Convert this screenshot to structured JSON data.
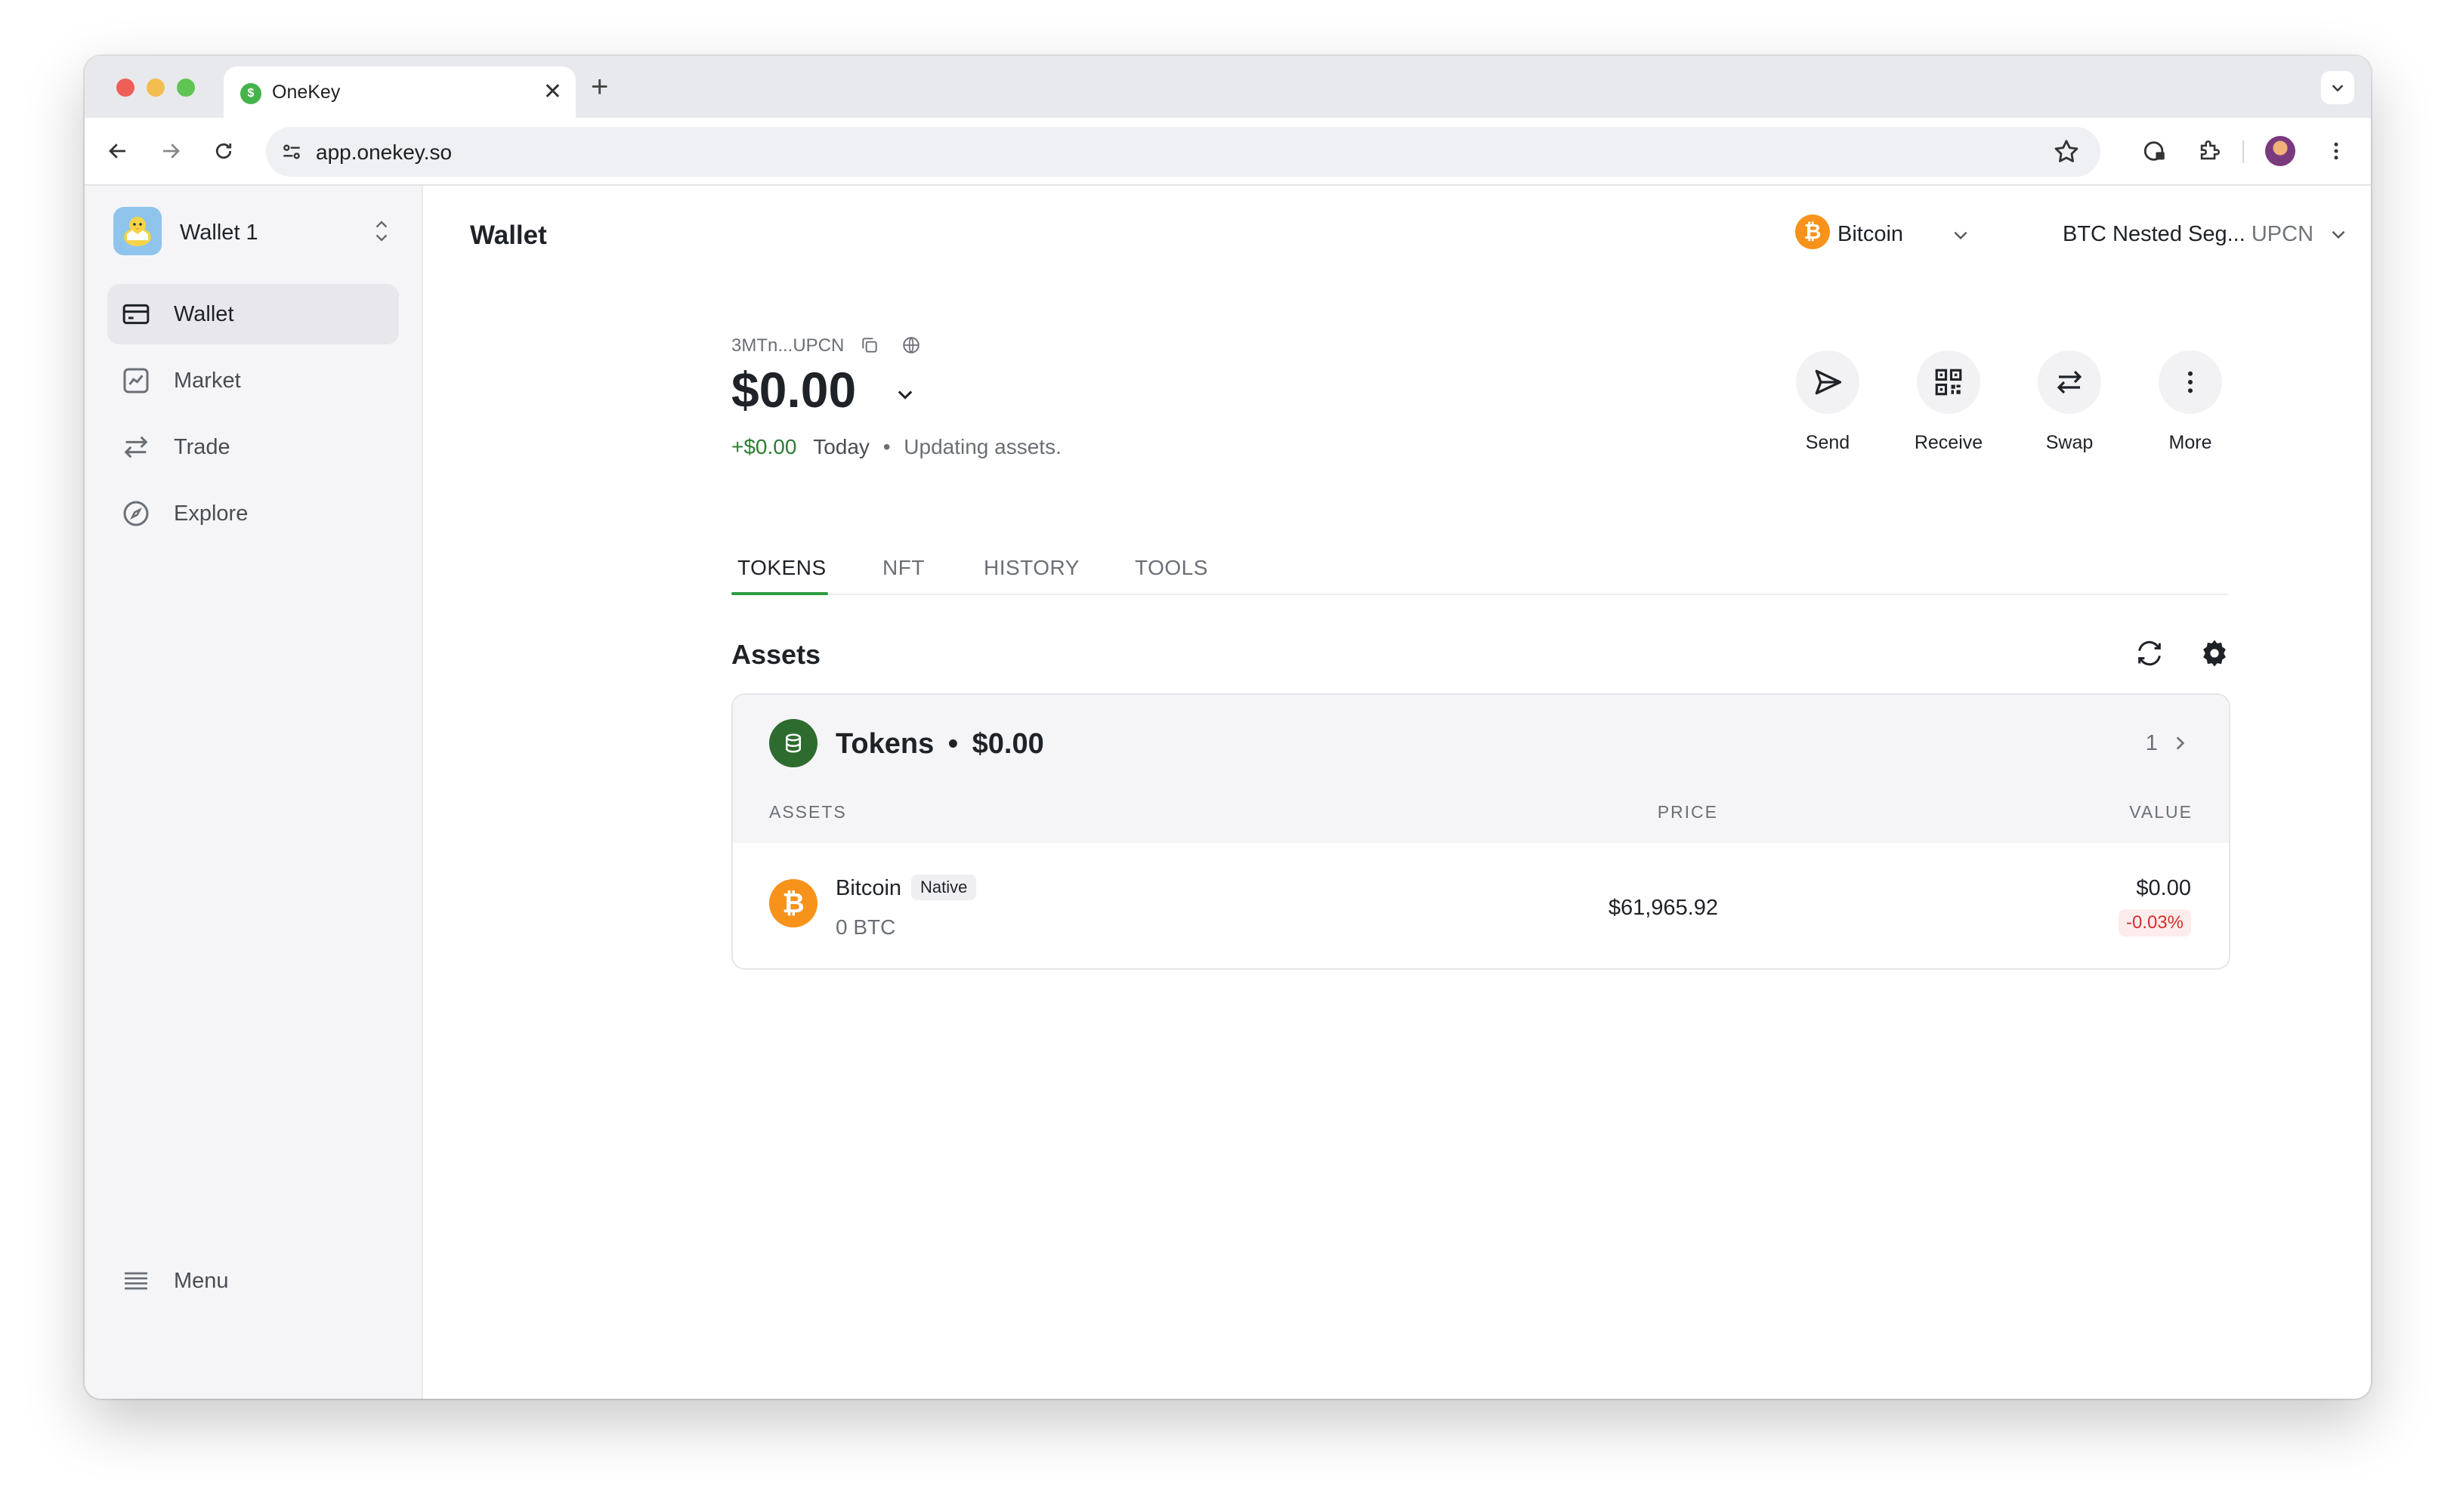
{
  "browser": {
    "tab_title": "OneKey",
    "tab_favicon_glyph": "$",
    "close_glyph": "✕",
    "new_tab_glyph": "+",
    "url": "app.onekey.so"
  },
  "sidebar": {
    "wallet_name": "Wallet 1",
    "items": [
      {
        "label": "Wallet",
        "icon": "wallet-icon",
        "active": true
      },
      {
        "label": "Market",
        "icon": "chart-icon",
        "active": false
      },
      {
        "label": "Trade",
        "icon": "swap-arrows-icon",
        "active": false
      },
      {
        "label": "Explore",
        "icon": "compass-icon",
        "active": false
      }
    ],
    "menu_label": "Menu"
  },
  "header": {
    "title": "Wallet",
    "network": "Bitcoin",
    "account": "BTC Nested Seg...",
    "account_suffix": "UPCN"
  },
  "account": {
    "address": "3MTn...UPCN",
    "balance": "$0.00",
    "change": "+$0.00",
    "change_period": "Today",
    "separator": "•",
    "status": "Updating assets."
  },
  "actions": [
    {
      "label": "Send",
      "icon": "send-icon"
    },
    {
      "label": "Receive",
      "icon": "qr-code-icon"
    },
    {
      "label": "Swap",
      "icon": "swap-icon"
    },
    {
      "label": "More",
      "icon": "more-vertical-icon"
    }
  ],
  "tabs": [
    {
      "label": "TOKENS",
      "active": true
    },
    {
      "label": "NFT",
      "active": false
    },
    {
      "label": "HISTORY",
      "active": false
    },
    {
      "label": "TOOLS",
      "active": false
    }
  ],
  "assets": {
    "title": "Assets",
    "group_title": "Tokens",
    "group_separator": "•",
    "group_value": "$0.00",
    "group_count": "1",
    "columns": {
      "assets": "ASSETS",
      "price": "PRICE",
      "value": "VALUE"
    },
    "rows": [
      {
        "name": "Bitcoin",
        "badge": "Native",
        "balance": "0 BTC",
        "price": "$61,965.92",
        "value": "$0.00",
        "change": "-0.03%"
      }
    ]
  },
  "colors": {
    "accent_green": "#2e9c42",
    "bitcoin_orange": "#f7931a",
    "negative_red": "#d32f2f",
    "positive_green": "#2e7d32"
  }
}
